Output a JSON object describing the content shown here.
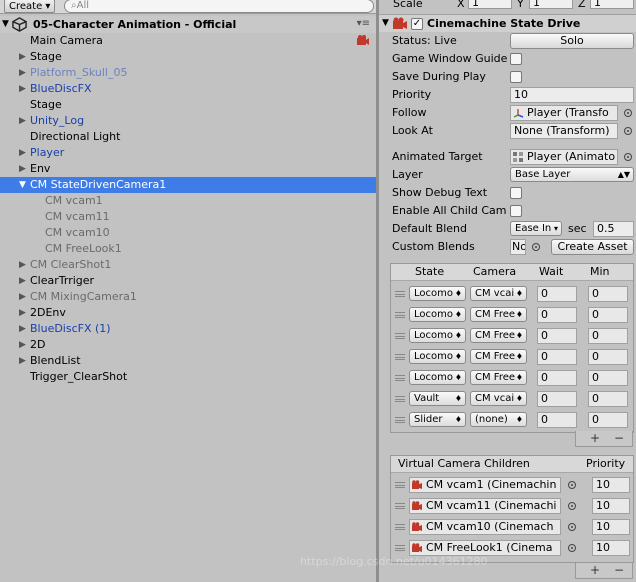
{
  "hierarchy": {
    "create_label": "Create",
    "search_placeholder": "All",
    "scene_title": "05-Character Animation - Official",
    "items": [
      {
        "label": "Main Camera"
      },
      {
        "label": "Stage"
      },
      {
        "label": "Platform_Skull_05"
      },
      {
        "label": "BlueDiscFX"
      },
      {
        "label": "Stage"
      },
      {
        "label": "Unity_Log"
      },
      {
        "label": "Directional Light"
      },
      {
        "label": "Player"
      },
      {
        "label": "Env"
      },
      {
        "label": "CM StateDrivenCamera1"
      },
      {
        "label": "CM vcam1"
      },
      {
        "label": "CM vcam11"
      },
      {
        "label": "CM vcam10"
      },
      {
        "label": "CM FreeLook1"
      },
      {
        "label": "CM ClearShot1"
      },
      {
        "label": "ClearTrriger"
      },
      {
        "label": "CM MixingCamera1"
      },
      {
        "label": "2DEnv"
      },
      {
        "label": "BlueDiscFX (1)"
      },
      {
        "label": "2D"
      },
      {
        "label": "BlendList"
      },
      {
        "label": "Trigger_ClearShot"
      }
    ]
  },
  "inspector": {
    "scale_label": "Scale",
    "x_label": "X",
    "x_value": "1",
    "y_label": "Y",
    "y_value": "1",
    "z_label": "Z",
    "z_value": "1",
    "component_title": "Cinemachine State Drive",
    "status_label": "Status: Live",
    "solo_label": "Solo",
    "game_window_guides": "Game Window Guide",
    "save_during_play": "Save During Play",
    "priority_label": "Priority",
    "priority_value": "10",
    "follow_label": "Follow",
    "follow_value": "Player (Transfo",
    "look_at_label": "Look At",
    "look_at_value": "None (Transform)",
    "animated_target_label": "Animated Target",
    "animated_target_value": "Player (Animato",
    "layer_label": "Layer",
    "layer_value": "Base Layer",
    "show_debug_text": "Show Debug Text",
    "enable_all_child": "Enable All Child Cam",
    "default_blend_label": "Default Blend",
    "default_blend_value": "Ease In",
    "sec_label": "sec",
    "blend_seconds": "0.5",
    "custom_blends_label": "Custom Blends",
    "custom_blends_value": "No",
    "create_asset_label": "Create Asset",
    "states_table": {
      "headers": [
        "State",
        "Camera",
        "Wait",
        "Min"
      ],
      "rows": [
        {
          "state": "Locomo",
          "camera": "CM vcai",
          "wait": "0",
          "min": "0"
        },
        {
          "state": "Locomo",
          "camera": "CM Free",
          "wait": "0",
          "min": "0"
        },
        {
          "state": "Locomo",
          "camera": "CM Free",
          "wait": "0",
          "min": "0"
        },
        {
          "state": "Locomo",
          "camera": "CM Free",
          "wait": "0",
          "min": "0"
        },
        {
          "state": "Locomo",
          "camera": "CM Free",
          "wait": "0",
          "min": "0"
        },
        {
          "state": "Vault",
          "camera": "CM vcai",
          "wait": "0",
          "min": "0"
        },
        {
          "state": "Slider",
          "camera": "(none)",
          "wait": "0",
          "min": "0"
        }
      ]
    },
    "children_table": {
      "headers": [
        "Virtual Camera Children",
        "Priority"
      ],
      "rows": [
        {
          "name": "CM vcam1 (Cinemachin",
          "priority": "10"
        },
        {
          "name": "CM vcam11 (Cinemachi",
          "priority": "10"
        },
        {
          "name": "CM vcam10 (Cinemach",
          "priority": "10"
        },
        {
          "name": "CM FreeLook1 (Cinema",
          "priority": "10"
        }
      ]
    },
    "add_symbol": "+",
    "remove_symbol": "−"
  },
  "watermark": "https://blog.csdn.net/u014361280"
}
